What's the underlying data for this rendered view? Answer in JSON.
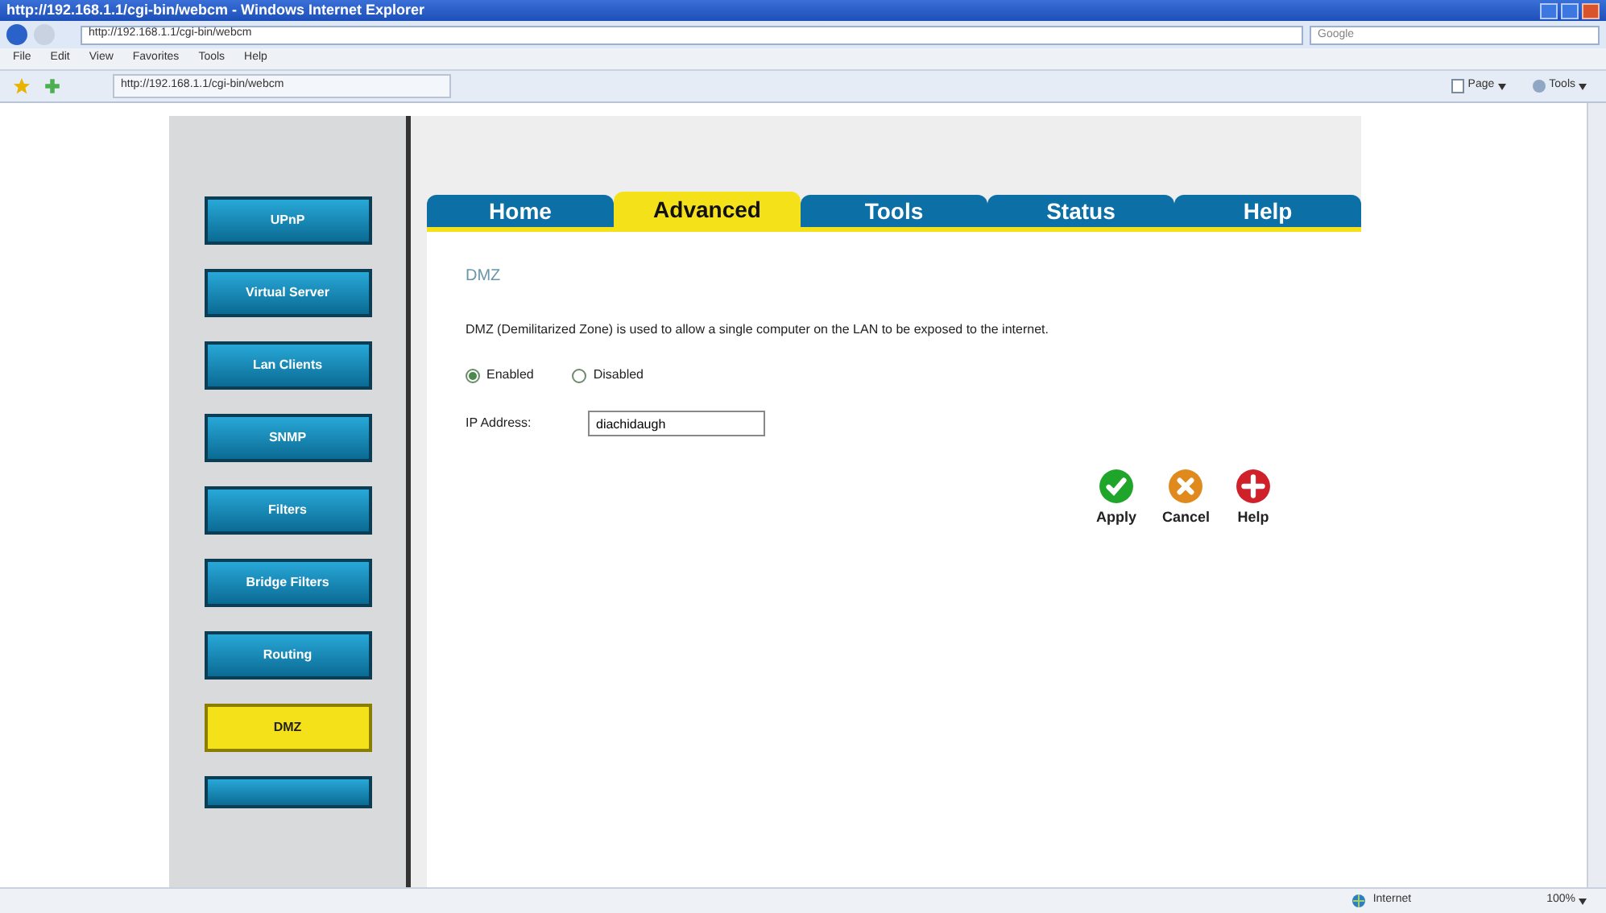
{
  "window": {
    "title": "http://192.168.1.1/cgi-bin/webcm - Windows Internet Explorer"
  },
  "address_bar": {
    "url": "http://192.168.1.1/cgi-bin/webcm"
  },
  "search": {
    "placeholder": "Google"
  },
  "menu": [
    "File",
    "Edit",
    "View",
    "Favorites",
    "Tools",
    "Help"
  ],
  "favorites_tab": {
    "title": "http://192.168.1.1/cgi-bin/webcm"
  },
  "command_bar": [
    {
      "label": "Page",
      "kind": "page"
    },
    {
      "label": "Tools",
      "kind": "tools"
    }
  ],
  "sidebar": {
    "items": [
      {
        "label": "UPnP",
        "selected": false
      },
      {
        "label": "Virtual Server",
        "selected": false
      },
      {
        "label": "Lan Clients",
        "selected": false
      },
      {
        "label": "SNMP",
        "selected": false
      },
      {
        "label": "Filters",
        "selected": false
      },
      {
        "label": "Bridge Filters",
        "selected": false
      },
      {
        "label": "Routing",
        "selected": false
      },
      {
        "label": "DMZ",
        "selected": true
      }
    ]
  },
  "tabs": [
    {
      "label": "Home",
      "selected": false
    },
    {
      "label": "Advanced",
      "selected": true
    },
    {
      "label": "Tools",
      "selected": false
    },
    {
      "label": "Status",
      "selected": false
    },
    {
      "label": "Help",
      "selected": false
    }
  ],
  "section": {
    "title": "DMZ",
    "description": "DMZ (Demilitarized Zone) is used to allow a single computer on the LAN to be exposed to the internet."
  },
  "radios": [
    {
      "label": "Enabled",
      "selected": true
    },
    {
      "label": "Disabled",
      "selected": false
    }
  ],
  "ip_field": {
    "label": "IP Address:",
    "value": "diachidaugh"
  },
  "actions": [
    {
      "label": "Apply",
      "kind": "apply"
    },
    {
      "label": "Cancel",
      "kind": "cancel"
    },
    {
      "label": "Help",
      "kind": "help"
    }
  ],
  "status_bar": {
    "zone": "Internet",
    "zoom": "100%"
  }
}
